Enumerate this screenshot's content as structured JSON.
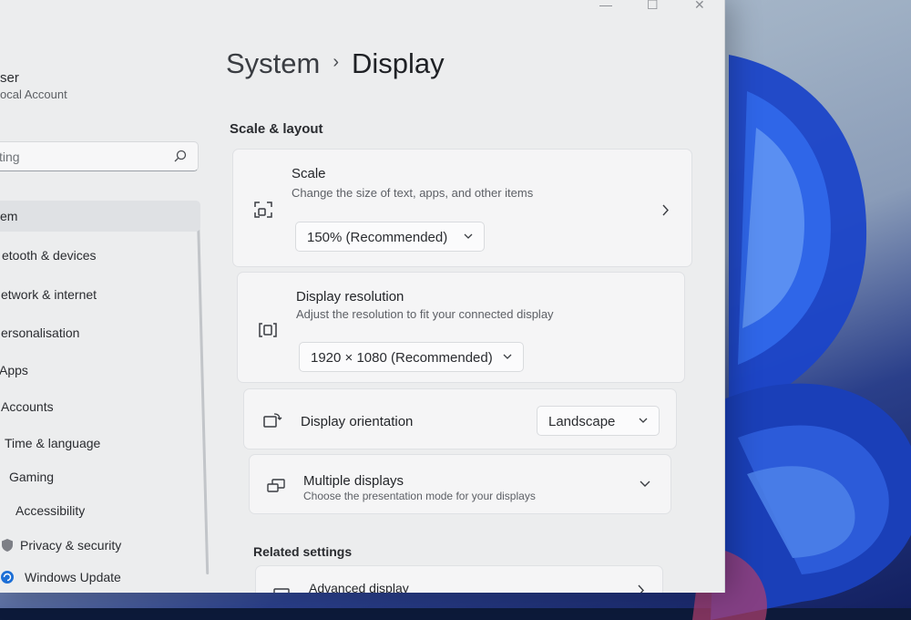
{
  "window": {
    "controls": [
      "—",
      "☐",
      "✕"
    ]
  },
  "sidebar": {
    "user_name": "ser",
    "user_account": "ocal Account",
    "search_placeholder": "ting",
    "items": [
      {
        "label": "em",
        "active": true
      },
      {
        "label": "etooth & devices"
      },
      {
        "label": "etwork & internet"
      },
      {
        "label": "ersonalisation"
      },
      {
        "label": "Apps"
      },
      {
        "label": "Accounts"
      },
      {
        "label": "Time & language"
      },
      {
        "label": "Gaming"
      },
      {
        "label": "Accessibility"
      },
      {
        "label": "Privacy & security"
      },
      {
        "label": "Windows Update"
      }
    ]
  },
  "header": {
    "parent": "System",
    "separator": "›",
    "current": "Display"
  },
  "sections": {
    "scale_layout": "Scale & layout",
    "related_settings": "Related settings"
  },
  "cards": {
    "scale": {
      "title": "Scale",
      "subtitle": "Change the size of text, apps, and other items",
      "value": "150% (Recommended)"
    },
    "resolution": {
      "title": "Display resolution",
      "subtitle": "Adjust the resolution to fit your connected display",
      "value": "1920 × 1080 (Recommended)"
    },
    "orientation": {
      "title": "Display orientation",
      "value": "Landscape"
    },
    "multiple": {
      "title": "Multiple displays",
      "subtitle": "Choose the presentation mode for your displays"
    },
    "advanced": {
      "title": "Advanced display"
    }
  }
}
